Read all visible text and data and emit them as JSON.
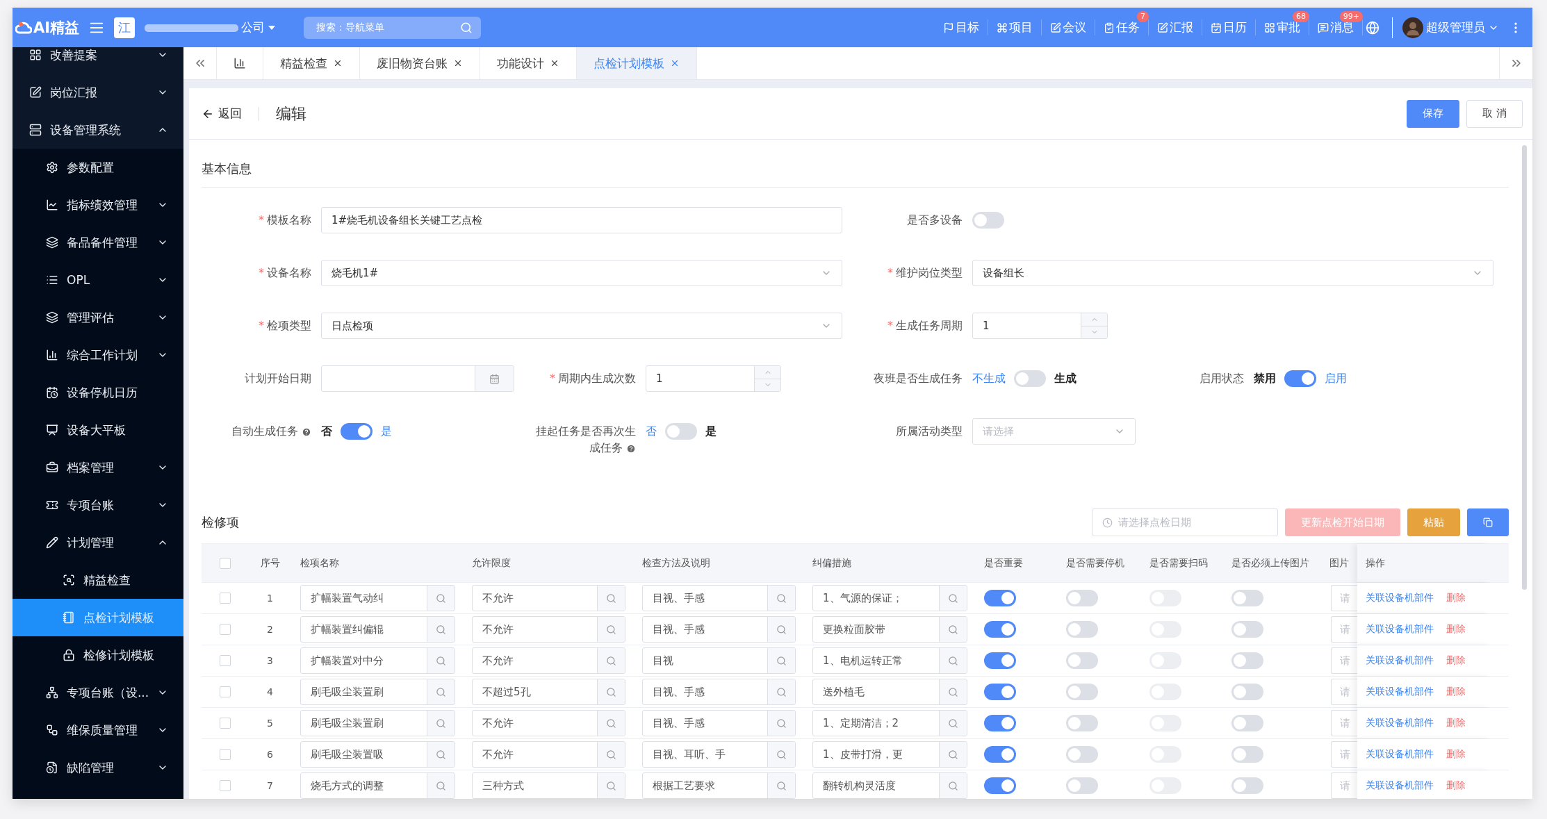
{
  "topbar": {
    "logo": "AI精益",
    "org_badge": "江",
    "company": "公司",
    "search": {
      "placeholder": "搜索：导航菜单"
    },
    "nav": [
      {
        "label": "目标"
      },
      {
        "label": "项目"
      },
      {
        "label": "会议"
      },
      {
        "label": "任务",
        "badge": "7"
      },
      {
        "label": "汇报"
      },
      {
        "label": "日历"
      },
      {
        "label": "审批",
        "badge": "68"
      },
      {
        "label": "消息",
        "badge": "99+"
      }
    ],
    "user": "超级管理员"
  },
  "sidebar": {
    "items": [
      {
        "label": "改善提案",
        "expanded": false
      },
      {
        "label": "岗位汇报",
        "expanded": false
      },
      {
        "label": "设备管理系统",
        "expanded": true,
        "children": [
          {
            "label": "参数配置"
          },
          {
            "label": "指标绩效管理",
            "expanded": false
          },
          {
            "label": "备品备件管理",
            "expanded": false
          },
          {
            "label": "OPL",
            "expanded": false
          },
          {
            "label": "管理评估",
            "expanded": false
          },
          {
            "label": "综合工作计划",
            "expanded": false
          },
          {
            "label": "设备停机日历"
          },
          {
            "label": "设备大平板"
          },
          {
            "label": "档案管理",
            "expanded": false
          },
          {
            "label": "专项台账",
            "expanded": false
          },
          {
            "label": "计划管理",
            "expanded": true,
            "children": [
              {
                "label": "精益检查",
                "selected": false
              },
              {
                "label": "点检计划模板",
                "selected": true
              },
              {
                "label": "检修计划模板",
                "selected": false
              }
            ]
          },
          {
            "label": "专项台账（设...",
            "expanded": false
          },
          {
            "label": "维保质量管理",
            "expanded": false
          },
          {
            "label": "缺陷管理",
            "expanded": false
          }
        ]
      }
    ]
  },
  "tabs": [
    {
      "kind": "icon",
      "selected": false
    },
    {
      "kind": "text",
      "label": "精益检查",
      "selected": false
    },
    {
      "kind": "text",
      "label": "废旧物资台账",
      "selected": false
    },
    {
      "kind": "text",
      "label": "功能设计",
      "selected": false
    },
    {
      "kind": "text",
      "label": "点检计划模板",
      "selected": true
    }
  ],
  "header": {
    "back": "返回",
    "title": "编辑",
    "save": "保存",
    "cancel": "取 消"
  },
  "basic_info": {
    "title": "基本信息",
    "rows": [
      [
        {
          "kind": "text",
          "label": "模板名称",
          "required_mark": "*",
          "value": "1#烧毛机设备组长关键工艺点检"
        },
        {
          "kind": "switch",
          "label": "是否多设备",
          "on": false
        }
      ],
      [
        {
          "kind": "select",
          "label": "设备名称",
          "required_mark": "*",
          "value": "烧毛机1#"
        },
        {
          "kind": "select",
          "label": "维护岗位类型",
          "required_mark": "*",
          "value": "设备组长"
        }
      ],
      [
        {
          "kind": "select",
          "label": "检项类型",
          "required_mark": "*",
          "value": "日点检项"
        },
        {
          "kind": "number",
          "label": "生成任务周期",
          "required_mark": "*",
          "value": "1"
        }
      ],
      [
        {
          "kind": "date",
          "label": "计划开始日期"
        },
        {
          "kind": "number",
          "label": "周期内生成次数",
          "required_mark": "*",
          "value": "1"
        },
        {
          "kind": "labeled_switch",
          "label": "夜班是否生成任务",
          "off_text": "不生成",
          "on_text": "生成",
          "on": false
        },
        {
          "kind": "labeled_switch",
          "label": "启用状态",
          "off_text": "禁用",
          "on_text": "启用",
          "on": true
        }
      ],
      [
        {
          "kind": "labeled_switch",
          "label": "自动生成任务",
          "help": true,
          "off_text": "否",
          "on_text": "是",
          "on": true
        },
        {
          "kind": "labeled_switch",
          "label": "挂起任务是否再次生成任务",
          "help": true,
          "off_text": "否",
          "on_text": "是",
          "on": false
        },
        {
          "kind": "select",
          "label": "所属活动类型",
          "placeholder": "请选择"
        }
      ]
    ]
  },
  "inspection": {
    "title": "检修项",
    "date_placeholder": "请选择点检日期",
    "update_button": "更新点检开始日期",
    "paste_button": "粘贴",
    "all_checked": false,
    "columns": [
      "序号",
      "检项名称",
      "允许限度",
      "检查方法及说明",
      "纠偏措施",
      "是否重要",
      "是否需要停机",
      "是否需要扫码",
      "是否必须上传图片",
      "图片",
      "操作"
    ],
    "rows": [
      {
        "checked": false,
        "no": "1",
        "name": "扩幅装置气动纠",
        "limit": "不允许",
        "method": "目视、手感",
        "measure": "1、气源的保证；",
        "important": true,
        "shutdown": false,
        "scan": false,
        "upload": false,
        "image_placeholder": "请",
        "link": "关联设备机部件",
        "delete": "删除"
      },
      {
        "checked": false,
        "no": "2",
        "name": "扩幅装置纠偏辊",
        "limit": "不允许",
        "method": "目视、手感",
        "measure": "更换粒面胶带",
        "important": true,
        "shutdown": false,
        "scan": false,
        "upload": false,
        "image_placeholder": "请",
        "link": "关联设备机部件",
        "delete": "删除"
      },
      {
        "checked": false,
        "no": "3",
        "name": "扩幅装置对中分",
        "limit": "不允许",
        "method": "目视",
        "measure": "1、电机运转正常",
        "important": true,
        "shutdown": false,
        "scan": false,
        "upload": false,
        "image_placeholder": "请",
        "link": "关联设备机部件",
        "delete": "删除"
      },
      {
        "checked": false,
        "no": "4",
        "name": "刷毛吸尘装置刷",
        "limit": "不超过5孔",
        "method": "目视、手感",
        "measure": "送外植毛",
        "important": true,
        "shutdown": false,
        "scan": false,
        "upload": false,
        "image_placeholder": "请",
        "link": "关联设备机部件",
        "delete": "删除"
      },
      {
        "checked": false,
        "no": "5",
        "name": "刷毛吸尘装置刷",
        "limit": "不允许",
        "method": "目视、手感",
        "measure": "1、定期清洁；2",
        "important": true,
        "shutdown": false,
        "scan": false,
        "upload": false,
        "image_placeholder": "请",
        "link": "关联设备机部件",
        "delete": "删除"
      },
      {
        "checked": false,
        "no": "6",
        "name": "刷毛吸尘装置吸",
        "limit": "不允许",
        "method": "目视、耳听、手",
        "measure": "1、皮带打滑，更",
        "important": true,
        "shutdown": false,
        "scan": false,
        "upload": false,
        "image_placeholder": "请",
        "link": "关联设备机部件",
        "delete": "删除"
      },
      {
        "checked": false,
        "no": "7",
        "name": "烧毛方式的调整",
        "limit": "三种方式",
        "method": "根据工艺要求",
        "measure": "翻转机构灵活度",
        "important": true,
        "shutdown": false,
        "scan": false,
        "upload": false,
        "image_placeholder": "请",
        "link": "关联设备机部件",
        "delete": "删除"
      }
    ]
  }
}
